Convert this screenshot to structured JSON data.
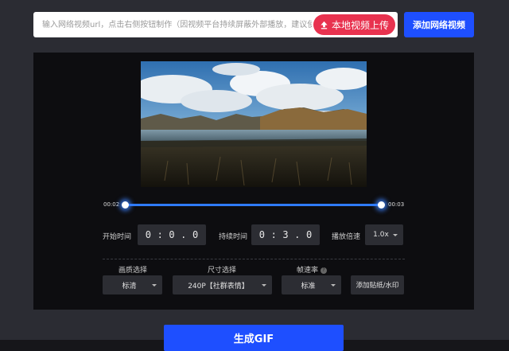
{
  "url_input": {
    "placeholder": "输入网络视频url，点击右侧按钮制作（因视频平台持续屏蔽外部播放，建议使用本地上传）"
  },
  "upload_button": {
    "label": "本地视频上传",
    "icon": "upload-icon"
  },
  "add_network_button": {
    "label": "添加网络视频"
  },
  "timeline": {
    "start_label": "00:02",
    "end_label": "00:03",
    "accent_color": "#1e5fff"
  },
  "start_time": {
    "label": "开始时间",
    "digits": [
      "0",
      ":",
      "0",
      ".",
      "0"
    ]
  },
  "duration": {
    "label": "持续时间",
    "digits": [
      "0",
      ":",
      "3",
      ".",
      "0"
    ]
  },
  "playback_speed": {
    "label": "播放倍速",
    "value": "1.0x"
  },
  "quality": {
    "label": "画质选择",
    "value": "标清"
  },
  "size": {
    "label": "尺寸选择",
    "value": "240P【社群表情】"
  },
  "frame_rate": {
    "label": "帧速率",
    "value": "标准",
    "help_icon": "question-icon"
  },
  "sticker_button": {
    "label": "添加贴纸/水印"
  },
  "generate_button": {
    "label": "生成GIF"
  },
  "colors": {
    "page_bg": "#2b2c33",
    "editor_bg": "#0d0d10",
    "primary_blue": "#1e4fff",
    "upload_red": "#e8324f"
  }
}
